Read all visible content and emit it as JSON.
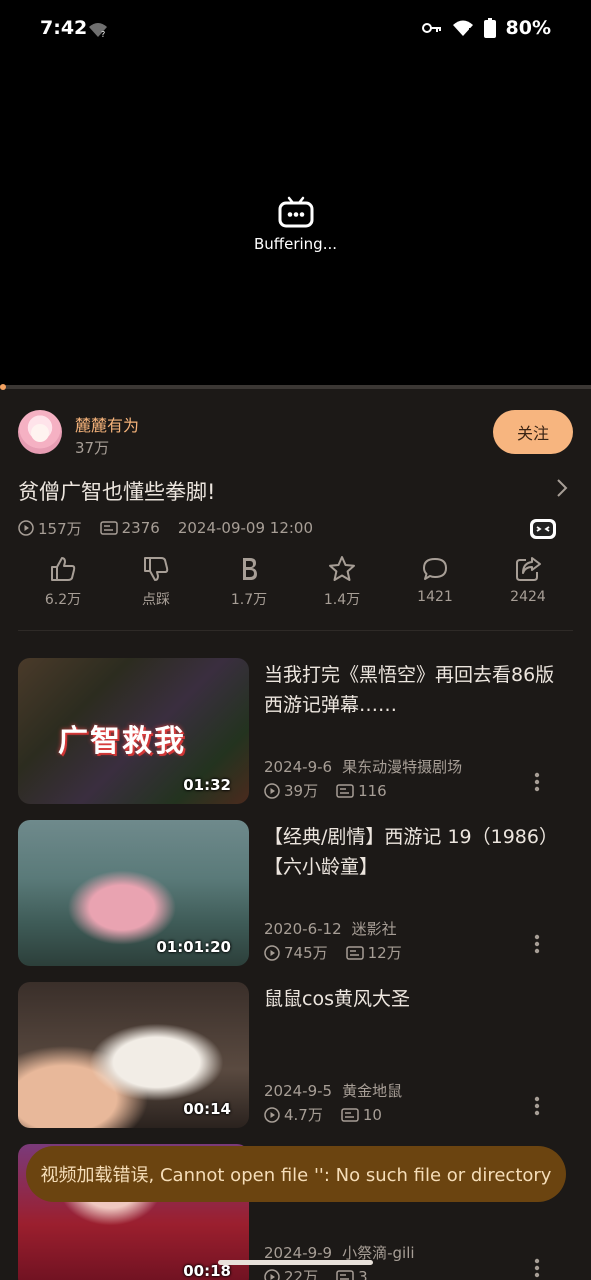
{
  "status": {
    "time": "7:42",
    "battery": "80%"
  },
  "player": {
    "buffering_text": "Buffering...",
    "progress": 0.0,
    "accent": "#f4a261"
  },
  "uploader": {
    "name": "麓麓有为",
    "fans": "37万",
    "follow_label": "关注"
  },
  "video": {
    "title": "贫僧广智也懂些拳脚!",
    "views": "157万",
    "danmaku": "2376",
    "date": "2024-09-09 12:00"
  },
  "actions": [
    {
      "icon": "like-icon",
      "label": "6.2万"
    },
    {
      "icon": "dislike-icon",
      "label": "点踩"
    },
    {
      "icon": "coin-icon",
      "label": "1.7万"
    },
    {
      "icon": "star-icon",
      "label": "1.4万"
    },
    {
      "icon": "comment-icon",
      "label": "1421"
    },
    {
      "icon": "share-icon",
      "label": "2424"
    }
  ],
  "related": [
    {
      "title": "当我打完《黑悟空》再回去看86版西游记弹幕……",
      "duration": "01:32",
      "overlay": "广智救我",
      "date": "2024-9-6",
      "author": "果东动漫特摄剧场",
      "views": "39万",
      "danmaku": "116"
    },
    {
      "title": "【经典/剧情】西游记 19（1986）【六小龄童】",
      "duration": "01:01:20",
      "date": "2020-6-12",
      "author": "迷影社",
      "views": "745万",
      "danmaku": "12万"
    },
    {
      "title": "鼠鼠cos黄风大圣",
      "duration": "00:14",
      "date": "2024-9-5",
      "author": "黄金地鼠",
      "views": "4.7万",
      "danmaku": "10"
    },
    {
      "title": "",
      "duration": "00:18",
      "date": "2024-9-9",
      "author": "小祭滴-gili",
      "views": "22万",
      "danmaku": "3"
    }
  ],
  "toast": {
    "message": "视频加载错误, Cannot open file '': No such file or directory"
  }
}
